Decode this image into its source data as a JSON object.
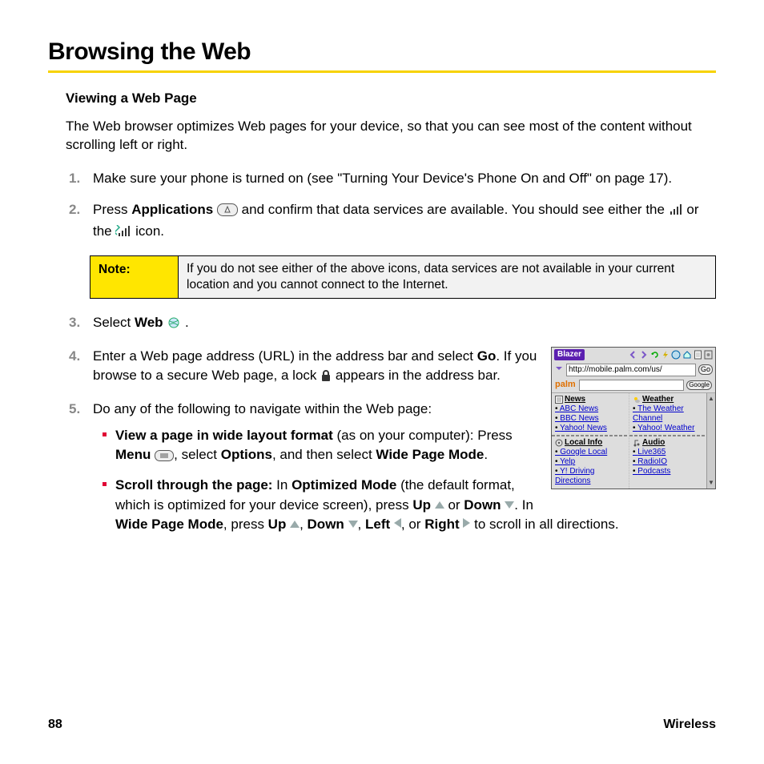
{
  "title": "Browsing the Web",
  "subhead": "Viewing a Web Page",
  "intro": "The Web browser optimizes Web pages for your device, so that you can see most of the content without scrolling left or right.",
  "steps": {
    "s1": {
      "n": "1.",
      "t1": "Make sure your phone is turned on (see \"Turning Your Device's Phone On and Off\" on page 17)."
    },
    "s2": {
      "n": "2.",
      "t1": "Press ",
      "b1": "Applications",
      "t2": " and confirm that data services are available. You should see either the ",
      "t3": " or the ",
      "t4": " icon."
    },
    "note": {
      "label": "Note:",
      "text": "If you do not see either of the above icons, data services are not available in your current location and you cannot connect to the Internet."
    },
    "s3": {
      "n": "3.",
      "t1": "Select ",
      "b1": "Web",
      "t2": "."
    },
    "s4": {
      "n": "4.",
      "t1": "Enter a Web page address (URL) in the address bar and select ",
      "b1": "Go",
      "t2": ". If you browse to a secure Web page, a lock ",
      "t3": " appears in the address bar."
    },
    "s5": {
      "n": "5.",
      "t1": "Do any of the following to navigate within the Web page:"
    },
    "sub1": {
      "b1": "View a page in wide layout format",
      "t1": " (as on your computer): Press ",
      "b2": "Menu",
      "t2": ", select ",
      "b3": "Options",
      "t3": ", and then select ",
      "b4": "Wide Page Mode",
      "t4": "."
    },
    "sub2": {
      "b1": "Scroll through the page:",
      "t1": " In ",
      "b2": "Optimized Mode",
      "t2": " (the default format, which is optimized for your device screen), press ",
      "b3": "Up",
      "t3": " or ",
      "b4": "Down",
      "t4": ". In ",
      "b5": "Wide Page Mode",
      "t5": ", press ",
      "b6": "Up",
      "t6": ", ",
      "b7": "Down",
      "t7": ", ",
      "b8": "Left",
      "t8": ", or ",
      "b9": "Right",
      "t9": " to scroll in all directions."
    }
  },
  "device": {
    "blazer": "Blazer",
    "url": "http://mobile.palm.com/us/",
    "go": "Go",
    "palm": "palm",
    "google": "Google",
    "headers": {
      "news": "News",
      "weather": "Weather",
      "local": "Local Info",
      "audio": "Audio"
    },
    "news": [
      "ABC News",
      "BBC News",
      "Yahoo! News"
    ],
    "weather": [
      "The Weather Channel",
      "Yahoo! Weather"
    ],
    "local": [
      "Google Local",
      "Yelp",
      "Y! Driving Directions"
    ],
    "audio": [
      "Live365",
      "RadioIO",
      "Podcasts"
    ]
  },
  "footer": {
    "page": "88",
    "section": "Wireless"
  }
}
